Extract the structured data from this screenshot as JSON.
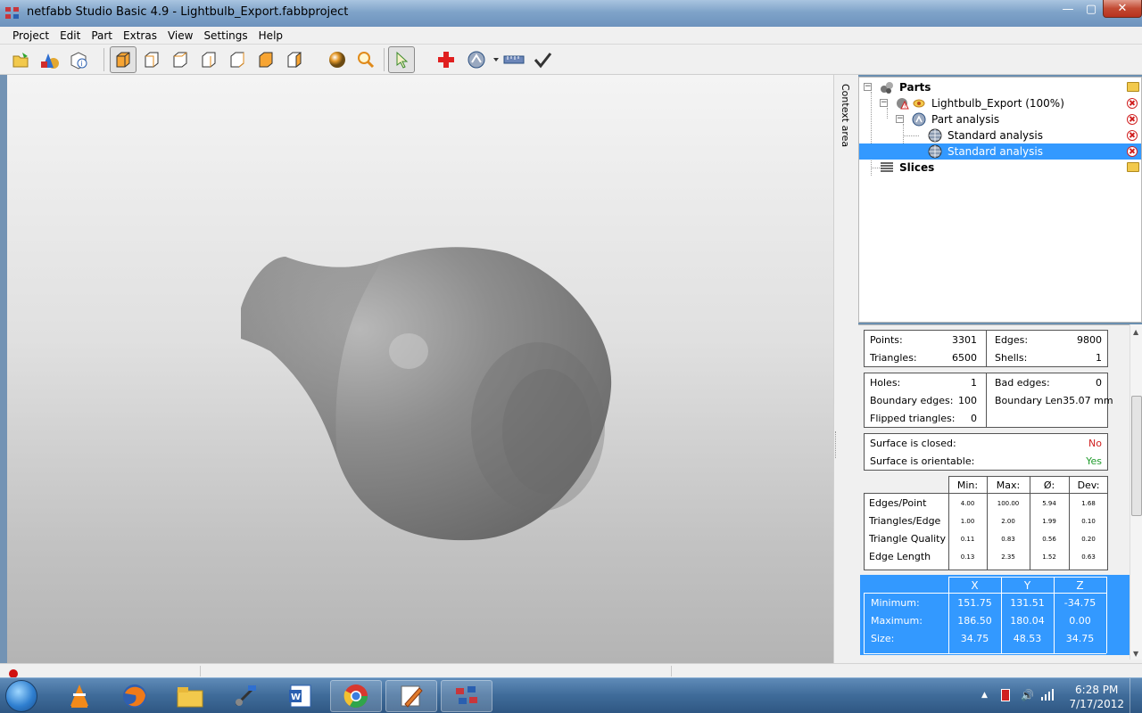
{
  "window": {
    "title": "netfabb Studio Basic 4.9 - Lightbulb_Export.fabbproject",
    "minimize": "—",
    "maximize": "▢",
    "close": "✕"
  },
  "menu": [
    "Project",
    "Edit",
    "Part",
    "Extras",
    "View",
    "Settings",
    "Help"
  ],
  "toolbar_icons": [
    "open-icon",
    "add-primitive-icon",
    "part-info-icon",
    "view-3d-icon",
    "view-front-icon",
    "view-back-icon",
    "view-left-icon",
    "view-right-icon",
    "view-top-icon",
    "view-bottom-icon",
    "shading-icon",
    "zoom-icon",
    "select-icon",
    "repair-icon",
    "analysis-icon",
    "measure-icon",
    "apply-icon"
  ],
  "context_area_label": "Context area",
  "tree": {
    "parts_label": "Parts",
    "part_label": "Lightbulb_Export (100%)",
    "analysis_label": "Part analysis",
    "standard_1": "Standard analysis",
    "standard_2": "Standard analysis",
    "slices_label": "Slices"
  },
  "analysis": {
    "points_label": "Points:",
    "points": "3301",
    "edges_label": "Edges:",
    "edges": "9800",
    "triangles_label": "Triangles:",
    "triangles": "6500",
    "shells_label": "Shells:",
    "shells": "1",
    "holes_label": "Holes:",
    "holes": "1",
    "bad_edges_label": "Bad edges:",
    "bad_edges": "0",
    "boundary_edges_label": "Boundary edges:",
    "boundary_edges": "100",
    "boundary_len_label": "Boundary Len35.07 mm",
    "flipped_label": "Flipped triangles:",
    "flipped": "0",
    "closed_label": "Surface is closed:",
    "closed": "No",
    "orientable_label": "Surface is orientable:",
    "orientable": "Yes",
    "stats_headers": [
      "Min:",
      "Max:",
      "Ø:",
      "Dev:"
    ],
    "stats_rows": [
      {
        "label": "Edges/Point",
        "values": [
          "4.00",
          "100.00",
          "5.94",
          "1.68"
        ]
      },
      {
        "label": "Triangles/Edge",
        "values": [
          "1.00",
          "2.00",
          "1.99",
          "0.10"
        ]
      },
      {
        "label": "Triangle Quality",
        "values": [
          "0.11",
          "0.83",
          "0.56",
          "0.20"
        ]
      },
      {
        "label": "Edge Length",
        "values": [
          "0.13",
          "2.35",
          "1.52",
          "0.63"
        ]
      }
    ],
    "extent_headers": [
      "X",
      "Y",
      "Z"
    ],
    "extent_rows": [
      {
        "label": "Minimum:",
        "values": [
          "151.75",
          "131.51",
          "-34.75"
        ]
      },
      {
        "label": "Maximum:",
        "values": [
          "186.50",
          "180.04",
          "0.00"
        ]
      },
      {
        "label": "Size:",
        "values": [
          "34.75",
          "48.53",
          "34.75"
        ]
      }
    ]
  },
  "taskbar": {
    "apps": [
      "vlc-icon",
      "firefox-icon",
      "explorer-icon",
      "tool-icon",
      "word-icon",
      "chrome-icon",
      "paint-icon",
      "netfabb-icon"
    ],
    "time": "6:28 PM",
    "date": "7/17/2012"
  },
  "colors": {
    "selection": "#3399ff",
    "no": "#d02020",
    "yes": "#1f9a2b"
  }
}
